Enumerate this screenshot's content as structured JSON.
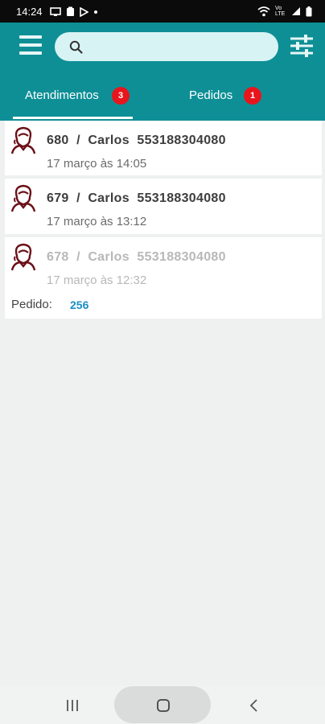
{
  "status_bar": {
    "time": "14:24",
    "left_icons": [
      "screen-cast-icon",
      "clipboard-icon",
      "play-store-icon",
      "dot-icon"
    ],
    "right_icons": [
      "wifi-icon",
      "volte-icon",
      "signal-icon",
      "battery-icon"
    ],
    "volte_text": "Vo LTE"
  },
  "header": {
    "search_placeholder": "",
    "search_value": "",
    "accent_color": "#0e8f96"
  },
  "tabs": [
    {
      "label": "Atendimentos",
      "badge": "3",
      "active": true
    },
    {
      "label": "Pedidos",
      "badge": "1",
      "active": false
    }
  ],
  "items": [
    {
      "title": "680  /  Carlos  553188304080",
      "date": "17 março às 14:05",
      "dimmed": false
    },
    {
      "title": "679  /  Carlos  553188304080",
      "date": "17 março às 13:12",
      "dimmed": false
    },
    {
      "title": "678  /  Carlos  553188304080",
      "date": "17 março às 12:32",
      "dimmed": true,
      "pedido_label": "Pedido:",
      "pedido_value": "256"
    }
  ],
  "nav": {
    "icons": [
      "recent-apps-icon",
      "home-icon",
      "back-icon"
    ]
  }
}
